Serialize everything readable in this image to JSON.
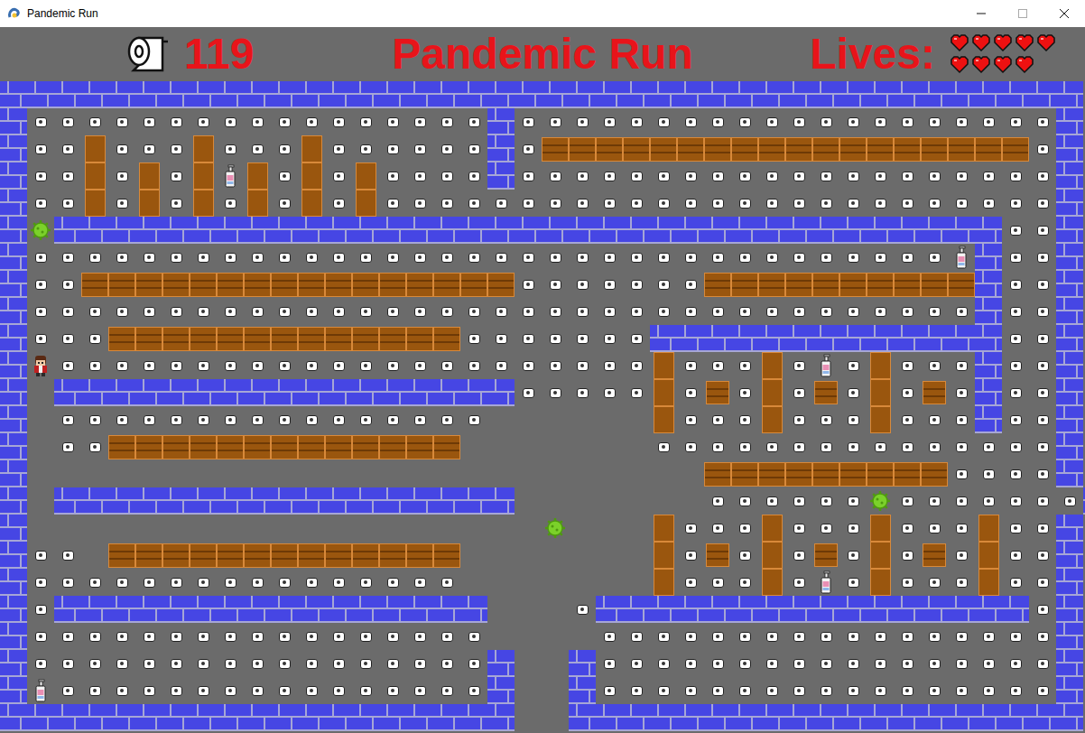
{
  "window": {
    "title": "Pandemic Run"
  },
  "hud": {
    "score": "119",
    "title": "Pandemic Run",
    "lives_label": "Lives:",
    "lives": 9
  },
  "maze": {
    "rows": [
      "########################################",
      "#ooooooooooooooooo#oooooooooooooooooooo#",
      "#ooSoooSoooSoooooo#oSSSSSSSSSSSSSSSSSSo#",
      "#ooSoSoSHSoSoSoooo#oooooooooooooooooooo#",
      "#ooSoSoSoSoSoSooooooooooooooooooooooooo#",
      "#V###################################oo#",
      "#ooooooooooooooooooooooooooooooooooH#oo#",
      "#ooSSSSSSSSSSSSSSSSoooooooSSSSSSSSSS#oo#",
      "#ooooooooooooooooooooooooooooooooooo#oo#",
      "#oooSSSSSSSSSSSSSooooooo#############oo#",
      "#PooooooooooooooooooooooSoooSoHoSooo#oo#",
      "#.#################oooooSoboSoboSobo#oo#",
      "#.oooooooooooooooo......SoooSoooSooo#oo#",
      "#.ooSSSSSSSSSSSSS.......ooooooooooooooo#",
      "#.........................SSSSSSSSSoooo#",
      "#.#################.......ooooooVooooooo#",
      "#...................V...SoooSoooSoooSoo#",
      "#oo.SSSSSSSSSSSSS.......SoboSoboSoboSoo#",
      "#oooooooooooooooo.......SoooSoHoSoooSoo#",
      "#o################...o################o#",
      "#ooooooooooooooooo....ooooooooooooooooo#",
      "#ooooooooooooooooo#..#ooooooooooooooooo#",
      "#Hoooooooooooooooo#..#ooooooooooooooooo#",
      "###################..###################"
    ]
  }
}
